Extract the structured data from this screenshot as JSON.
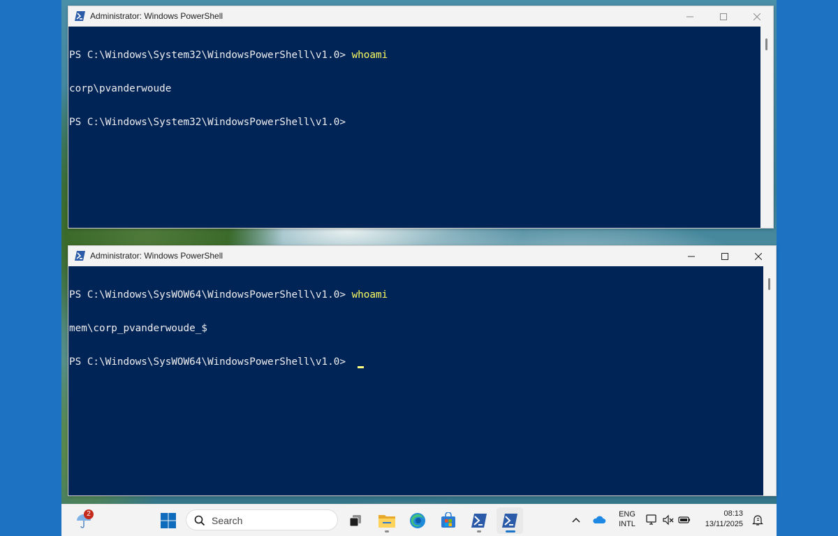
{
  "windows": [
    {
      "title": "Administrator: Windows PowerShell",
      "lines": [
        {
          "prompt": "PS C:\\Windows\\System32\\WindowsPowerShell\\v1.0> ",
          "command": "whoami"
        },
        {
          "output": "corp\\pvanderwoude"
        },
        {
          "prompt": "PS C:\\Windows\\System32\\WindowsPowerShell\\v1.0>",
          "command": ""
        }
      ]
    },
    {
      "title": "Administrator: Windows PowerShell",
      "lines": [
        {
          "prompt": "PS C:\\Windows\\SysWOW64\\WindowsPowerShell\\v1.0> ",
          "command": "whoami"
        },
        {
          "output": "mem\\corp_pvanderwoude_$"
        },
        {
          "prompt": "PS C:\\Windows\\SysWOW64\\WindowsPowerShell\\v1.0> ",
          "command": ""
        }
      ]
    }
  ],
  "taskbar": {
    "weather_badge": "2",
    "search_placeholder": "Search",
    "language": "ENG",
    "layout": "INTL",
    "time": "08:13",
    "date": "13/11/2025"
  },
  "colors": {
    "console_bg": "#012456",
    "console_fg": "#eeedf0",
    "command_fg": "#fefe60",
    "desktop_accent": "#1d72c2"
  }
}
